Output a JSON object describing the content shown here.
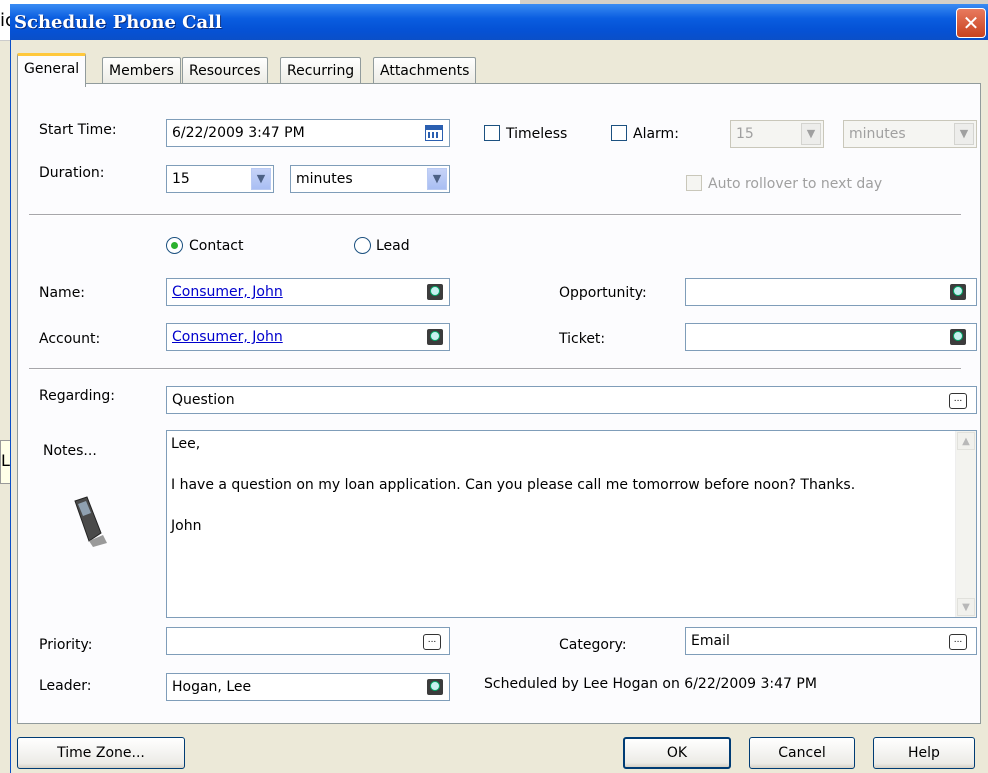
{
  "background_app": {
    "title_fragment": "ic",
    "side_fragment": "L"
  },
  "window": {
    "title": "Schedule Phone Call",
    "close_glyph": "✕"
  },
  "tabs": [
    {
      "label": "General",
      "active": true
    },
    {
      "label": "Members"
    },
    {
      "label": "Resources"
    },
    {
      "label": "Recurring"
    },
    {
      "label": "Attachments"
    }
  ],
  "schedule": {
    "start_time_label": "Start Time:",
    "start_time_value": "6/22/2009 3:47 PM",
    "timeless_label": "Timeless",
    "alarm_label": "Alarm:",
    "alarm_value": "15",
    "alarm_unit": "minutes",
    "duration_label": "Duration:",
    "duration_value": "15",
    "duration_unit": "minutes",
    "auto_rollover_label": "Auto rollover to next day"
  },
  "contact_type": {
    "contact_label": "Contact",
    "lead_label": "Lead",
    "selected": "Contact"
  },
  "party": {
    "name_label": "Name:",
    "name_value": "Consumer, John",
    "account_label": "Account:",
    "account_value": "Consumer, John",
    "opportunity_label": "Opportunity:",
    "opportunity_value": "",
    "ticket_label": "Ticket:",
    "ticket_value": ""
  },
  "details": {
    "regarding_label": "Regarding:",
    "regarding_value": "Question",
    "notes_label": "Notes...",
    "notes_lines": [
      "Lee,",
      "I have a question on my loan application.  Can you please call me tomorrow before noon?  Thanks.",
      "John"
    ],
    "priority_label": "Priority:",
    "priority_value": "",
    "category_label": "Category:",
    "category_value": "Email",
    "leader_label": "Leader:",
    "leader_value": "Hogan, Lee",
    "scheduled_by": "Scheduled by Lee Hogan on 6/22/2009 3:47 PM"
  },
  "buttons": {
    "time_zone": "Time Zone...",
    "ok": "OK",
    "cancel": "Cancel",
    "help": "Help"
  },
  "icons": {
    "close": "close-icon",
    "calendar": "calendar-icon",
    "lookup": "lookup-icon",
    "ellipsis": "ellipsis-icon",
    "phone": "cell-phone-icon",
    "dropdown": "chevron-down-icon"
  },
  "colors": {
    "title_bar": "#0552D6",
    "link": "#0000CC",
    "active_tab_accent": "#FFC83C"
  }
}
